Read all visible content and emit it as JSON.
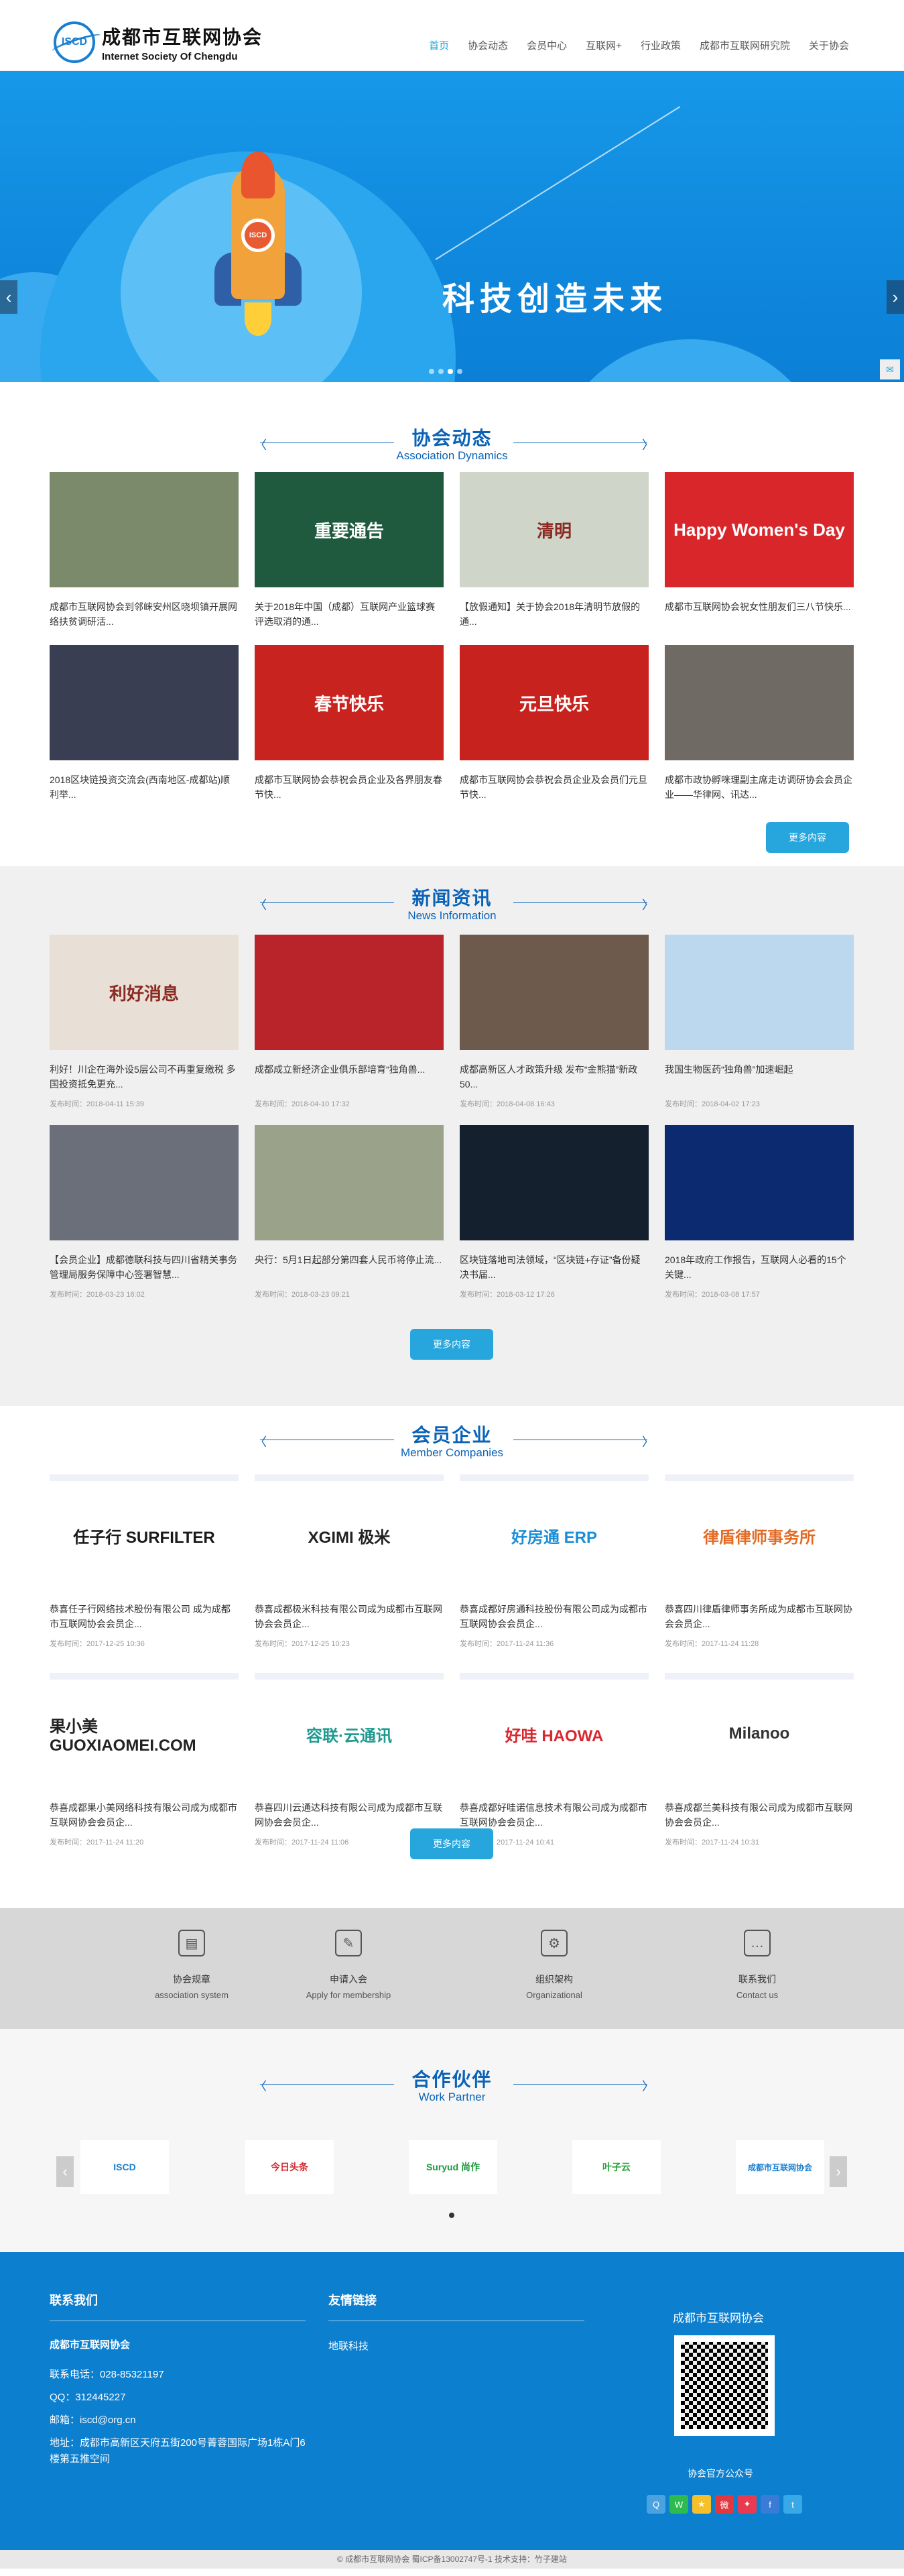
{
  "header": {
    "logo_mark": "ISCD",
    "logo_cn": "成都市互联网协会",
    "logo_en": "Internet Society Of Chengdu",
    "nav": [
      "首页",
      "协会动态",
      "会员中心",
      "互联网+",
      "行业政策",
      "成都市互联网研究院",
      "关于协会"
    ]
  },
  "banner": {
    "slogan": "科技创造未来",
    "rocket_label": "ISCD"
  },
  "dynamics": {
    "title_cn": "协会动态",
    "title_en": "Association Dynamics",
    "more": "更多内容",
    "items": [
      {
        "title": "成都市互联网协会到邻崃安州区晓坝镇开展网络扶贫调研活...",
        "color": "#7a8a6a",
        "image_text": ""
      },
      {
        "title": "关于2018年中国（成都）互联网产业篮球赛评选取消的通...",
        "color": "#1f5a3e",
        "image_text": "重要通告"
      },
      {
        "title": "【放假通知】关于协会2018年清明节放假的通...",
        "color": "#cfd6c9",
        "image_text": "清明"
      },
      {
        "title": "成都市互联网协会祝女性朋友们三八节快乐...",
        "color": "#d9262b",
        "image_text": "Happy Women's Day"
      },
      {
        "title": "2018区块链投资交流会(西南地区-成都站)顺利举...",
        "color": "#3a3e52",
        "image_text": ""
      },
      {
        "title": "成都市互联网协会恭祝会员企业及各界朋友春节快...",
        "color": "#c9231f",
        "image_text": "春节快乐"
      },
      {
        "title": "成都市互联网协会恭祝会员企业及会员们元旦节快...",
        "color": "#c8221e",
        "image_text": "元旦快乐"
      },
      {
        "title": "成都市政协孵咪理副主席走访调研协会会员企业——华律网、讯达...",
        "color": "#6f6a63",
        "image_text": ""
      }
    ]
  },
  "news": {
    "title_cn": "新闻资讯",
    "title_en": "News Information",
    "more": "更多内容",
    "date_prefix": "发布时间：",
    "items": [
      {
        "title": "利好！川企在海外设5层公司不再重复缴税 多国投资抵免更充...",
        "date": "2018-04-11 15:39",
        "color": "#e8e0d6",
        "image_text": "利好消息"
      },
      {
        "title": "成都成立新经济企业俱乐部培育“独角兽...",
        "date": "2018-04-10 17:32",
        "color": "#b8242a",
        "image_text": ""
      },
      {
        "title": "成都高新区人才政策升级 发布“金熊猫”新政50...",
        "date": "2018-04-08 16:43",
        "color": "#6d5a4d",
        "image_text": ""
      },
      {
        "title": "我国生物医药“独角兽”加速崛起",
        "date": "2018-04-02 17:23",
        "color": "#bcd8ef",
        "image_text": ""
      },
      {
        "title": "【会员企业】成都德联科技与四川省精关事务管理局服务保障中心签署智慧...",
        "date": "2018-03-23 16:02",
        "color": "#6a6f79",
        "image_text": ""
      },
      {
        "title": "央行：5月1日起部分第四套人民币将停止流...",
        "date": "2018-03-23 09:21",
        "color": "#9aa38a",
        "image_text": ""
      },
      {
        "title": "区块链落地司法领域，“区块链+存证”备份疑决书届...",
        "date": "2018-03-12 17:26",
        "color": "#15202e",
        "image_text": ""
      },
      {
        "title": "2018年政府工作报告，互联网人必看的15个关键...",
        "date": "2018-03-08 17:57",
        "color": "#0b2a6f",
        "image_text": ""
      }
    ]
  },
  "members": {
    "title_cn": "会员企业",
    "title_en": "Member Companies",
    "more": "更多内容",
    "date_prefix": "发布时间：",
    "items": [
      {
        "title": "恭喜任子行网络技术股份有限公司 成为成都市互联网协会会员企...",
        "date": "2017-12-25 10:36",
        "logo": "任子行 SURFILTER",
        "color": "#1a1a1a"
      },
      {
        "title": "恭喜成都极米科技有限公司成为成都市互联网协会会员企...",
        "date": "2017-12-25 10:23",
        "logo": "XGIMI 极米",
        "color": "#222"
      },
      {
        "title": "恭喜成都好房通科技股份有限公司成为成都市互联网协会会员企...",
        "date": "2017-11-24 11:36",
        "logo": "好房通 ERP",
        "color": "#1a8fd8"
      },
      {
        "title": "恭喜四川律盾律师事务所成为成都市互联网协会会员企...",
        "date": "2017-11-24 11:28",
        "logo": "律盾律师事务所",
        "color": "#e46a23"
      },
      {
        "title": "恭喜成都果小美网络科技有限公司成为成都市互联网协会会员企...",
        "date": "2017-11-24 11:20",
        "logo": "果小美 GUOXIAOMEI.COM",
        "color": "#222"
      },
      {
        "title": "恭喜四川云通达科技有限公司成为成都市互联网协会会员企...",
        "date": "2017-11-24 11:06",
        "logo": "容联·云通讯",
        "color": "#1f9a8f"
      },
      {
        "title": "恭喜成都好哇诺信息技术有限公司成为成都市互联网协会会员企...",
        "date": "2017-11-24 10:41",
        "logo": "好哇 HAOWA",
        "color": "#d7282f"
      },
      {
        "title": "恭喜成都兰美科技有限公司成为成都市互联网协会会员企...",
        "date": "2017-11-24 10:31",
        "logo": "Milanoo",
        "color": "#333"
      }
    ]
  },
  "features": [
    {
      "cn": "协会规章",
      "en": "association system",
      "icon": "book-icon",
      "glyph": "▤"
    },
    {
      "cn": "申请入会",
      "en": "Apply for membership",
      "icon": "edit-icon",
      "glyph": "✎"
    },
    {
      "cn": "组织架构",
      "en": "Organizational",
      "icon": "org-icon",
      "glyph": "⚙"
    },
    {
      "cn": "联系我们",
      "en": "Contact us",
      "icon": "chat-icon",
      "glyph": "…"
    }
  ],
  "partners": {
    "title_cn": "合作伙伴",
    "title_en": "Work Partner",
    "items": [
      "ISCD",
      "今日头条",
      "Suryud 尚作",
      "叶子云",
      "成都市互联网协会"
    ]
  },
  "footer": {
    "contact_title": "联系我们",
    "org_name": "成都市互联网协会",
    "phone": "联系电话：028-85321197",
    "qq": "QQ：312445227",
    "email": "邮箱：iscd@org.cn",
    "address": "地址：成都市高新区天府五街200号菁蓉国际广场1栋A门6楼第五推空间",
    "links_title": "友情链接",
    "link1": "地联科技",
    "qr_title": "成都市互联网协会",
    "qr_caption": "协会官方公众号",
    "copyright": "© 成都市互联网协会     蜀ICP备13002747号-1     技术支持：竹子建站"
  }
}
